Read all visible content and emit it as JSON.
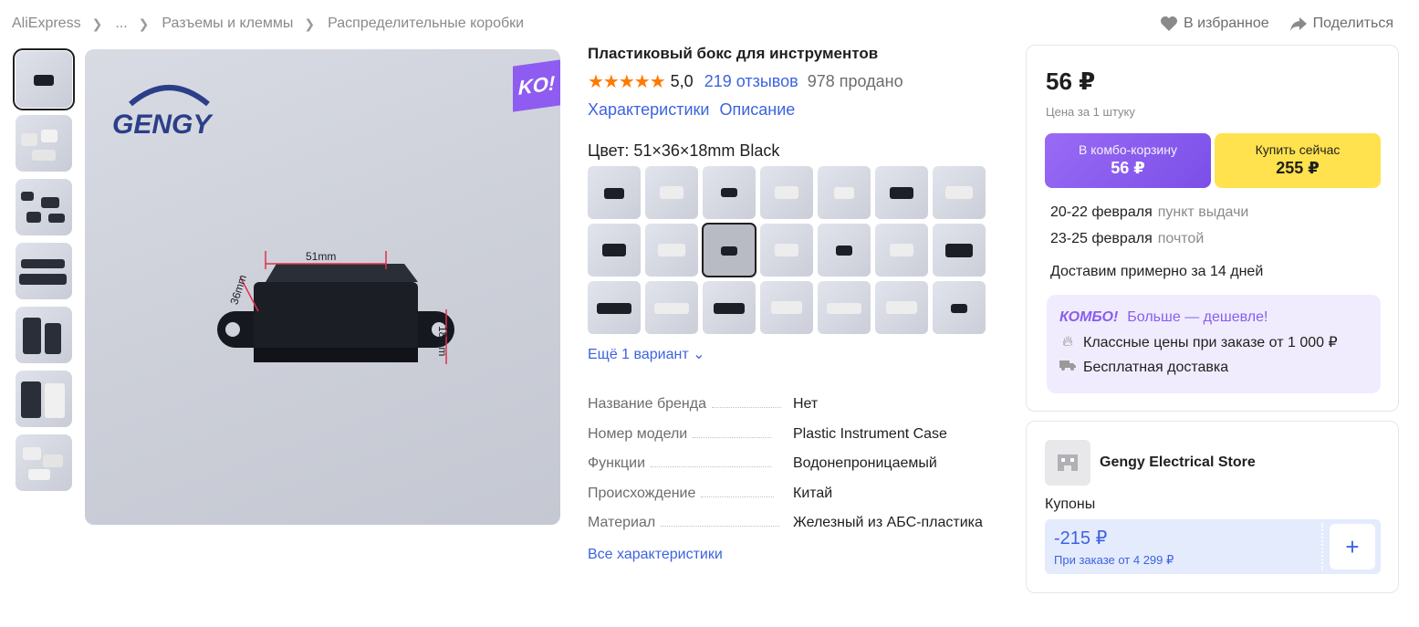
{
  "breadcrumb": {
    "items": [
      "AliExpress",
      "...",
      "Разъемы и клеммы",
      "Распределительные коробки"
    ],
    "sep": ">"
  },
  "top_actions": {
    "favorite": "В избранное",
    "share": "Поделиться"
  },
  "gallery": {
    "logo_text": "GENGY",
    "badge_text": "KO!",
    "dim_width": "51mm",
    "dim_depth": "36mm",
    "dim_height": "18mm"
  },
  "product": {
    "title": "Пластиковый бокс для инструментов",
    "stars": "★★★★★",
    "rating": "5,0",
    "reviews": "219 отзывов",
    "sold": "978 продано",
    "link_specs": "Характеристики",
    "link_description": "Описание",
    "color_label": "Цвет: 51×36×18mm Black",
    "more_variants": "Ещё 1 вариант",
    "all_specs": "Все характеристики",
    "specs": [
      {
        "key": "Название бренда",
        "value": "Нет"
      },
      {
        "key": "Номер модели",
        "value": "Plastic Instrument Case"
      },
      {
        "key": "Функции",
        "value": "Водонепроницаемый"
      },
      {
        "key": "Происхождение",
        "value": "Китай"
      },
      {
        "key": "Материал",
        "value": "Железный из АБС-пластика"
      }
    ]
  },
  "buy": {
    "price": "56 ₽",
    "unit": "Цена за 1 штуку",
    "combo_label": "В комбо-корзину",
    "combo_price": "56 ₽",
    "buy_label": "Купить сейчас",
    "buy_price": "255 ₽",
    "delivery": [
      {
        "date": "20-22 февраля",
        "method": "пункт выдачи"
      },
      {
        "date": "23-25 февраля",
        "method": "почтой"
      }
    ],
    "delivery_estimate": "Доставим примерно за 14 дней",
    "combo_brand": "КОМБО!",
    "combo_tagline": "Больше — дешевле!",
    "combo_benefit_1": "Классные цены при заказе от 1 000 ₽",
    "combo_benefit_2": "Бесплатная доставка"
  },
  "store": {
    "name": "Gengy Electrical Store",
    "coupons_label": "Купоны",
    "coupon_amount": "-215 ₽",
    "coupon_condition": "При заказе от 4 299 ₽",
    "add": "+"
  },
  "colors": {
    "accent_blue": "#3d63e0",
    "star_orange": "#ff7a00",
    "combo_purple": "#8a5cf0",
    "buy_yellow": "#ffe24d"
  }
}
